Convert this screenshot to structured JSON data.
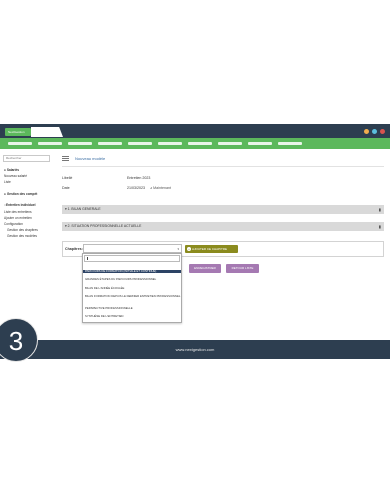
{
  "app": {
    "tab_label": "NextGestion"
  },
  "window_buttons": {
    "colors": [
      "#f0ad4e",
      "#5bc0de",
      "#d9534f"
    ]
  },
  "sidebar": {
    "select_placeholder": "Rechercher",
    "items": [
      {
        "label": "Salariés",
        "heading": true,
        "icon": "user-icon"
      },
      {
        "label": "Nouveau salarié",
        "heading": false
      },
      {
        "label": "Liste",
        "heading": false
      },
      {
        "label": "Gestion des compét",
        "heading": true,
        "icon": "user-icon"
      },
      {
        "label": "Entretien individuel",
        "heading": true,
        "icon": "chat-icon"
      },
      {
        "label": "Liste des entretiens",
        "heading": false
      },
      {
        "label": "Ajouter un entretien",
        "heading": false
      },
      {
        "label": "Configuration",
        "heading": false
      },
      {
        "label": "Gestion des chapitres",
        "heading": false
      },
      {
        "label": "Gestion des modèles",
        "heading": false
      }
    ]
  },
  "main": {
    "title": "Nouveau modèle",
    "fields": [
      {
        "label": "Libellé",
        "value": "Entretien 2023"
      },
      {
        "label": "Date",
        "value": "21/03/2023",
        "extra": "Maintenant"
      }
    ],
    "sections": [
      {
        "label": "▾ 1. BILAN GENERALE"
      },
      {
        "label": "▾ 2. SITUATION PROFESSIONNELLE ACTUELLE"
      }
    ],
    "chapter_label": "Chapitres:",
    "add_chapter_button": "AJOUTER CE CHAPITRE",
    "save_button": "ENREGISTRER",
    "back_button": "RETOUR LISTE"
  },
  "dropdown": {
    "options": [
      "PARCOURS DE FORMATION (INITIALE ET CONTINUE)",
      "GRANDES ÉTAPES DU PARCOURS PROFESSIONNEL",
      "BILAN DE L'ANNÉE ÉCOULÉE",
      "BILAN FORMATION DEPUIS LE DERNIER ENTRETIEN PROFESSIONNEL",
      "PERSPECTIVE PROFESSIONNELLE",
      "SYNTHÈSE DE L'ENTRETIEN"
    ],
    "selected_index": 0
  },
  "footer": {
    "text": "www.nextgestion.com",
    "step": "3"
  }
}
